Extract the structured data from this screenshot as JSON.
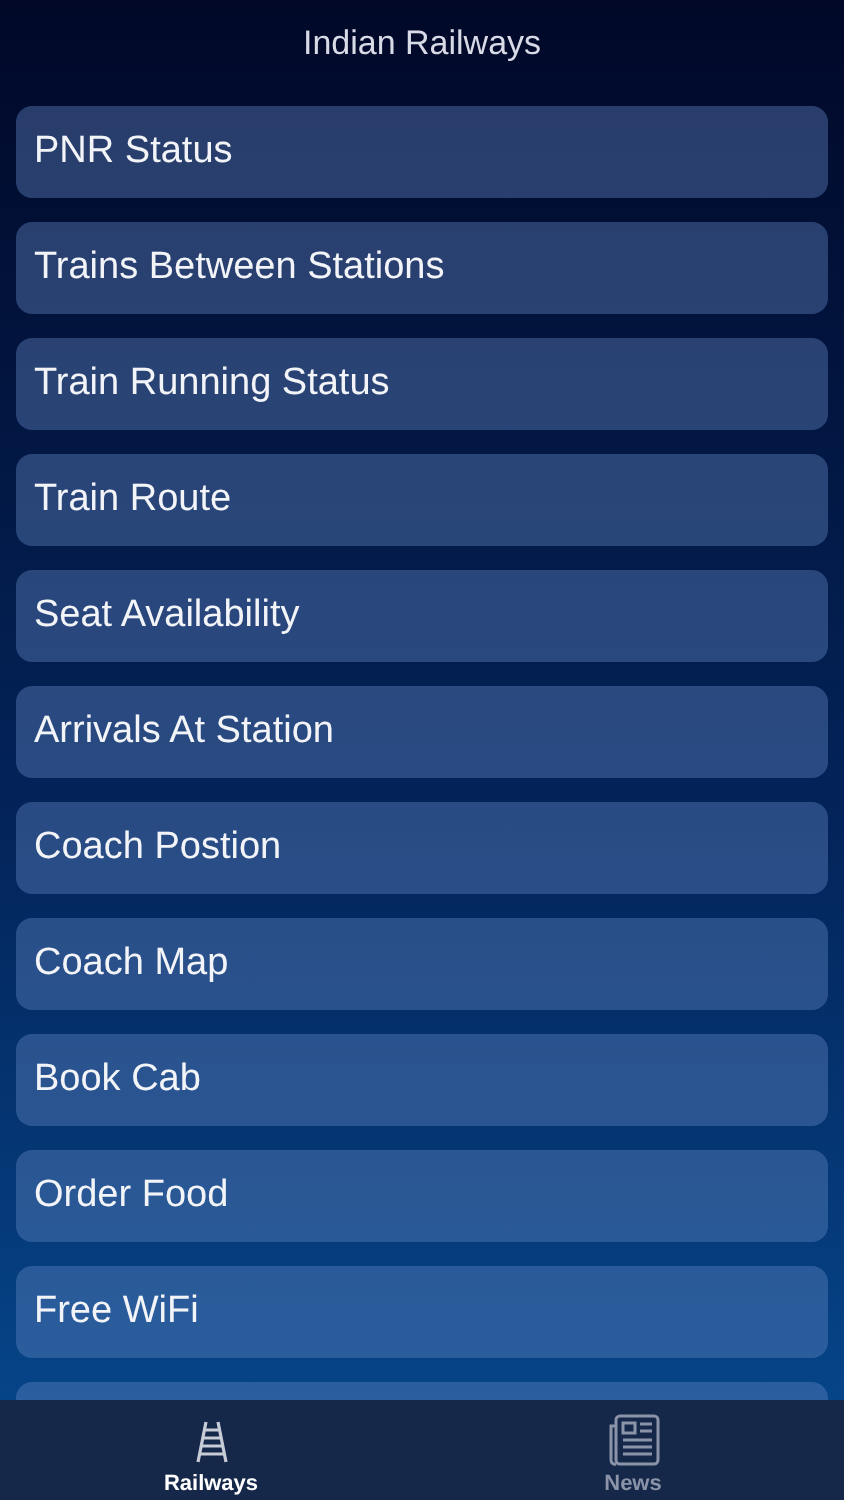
{
  "navigation_bar": {
    "title": "Indian Railways"
  },
  "menu_items": [
    {
      "label": "PNR Status"
    },
    {
      "label": "Trains Between Stations"
    },
    {
      "label": "Train Running Status"
    },
    {
      "label": "Train Route"
    },
    {
      "label": "Seat Availability"
    },
    {
      "label": "Arrivals At Station"
    },
    {
      "label": "Coach Postion"
    },
    {
      "label": "Coach Map"
    },
    {
      "label": "Book Cab"
    },
    {
      "label": "Order Food"
    },
    {
      "label": "Free WiFi"
    }
  ],
  "tab_bar": [
    {
      "label": "Railways",
      "selected": true,
      "kind": "railway"
    },
    {
      "label": "News",
      "selected": false,
      "kind": "news"
    }
  ]
}
